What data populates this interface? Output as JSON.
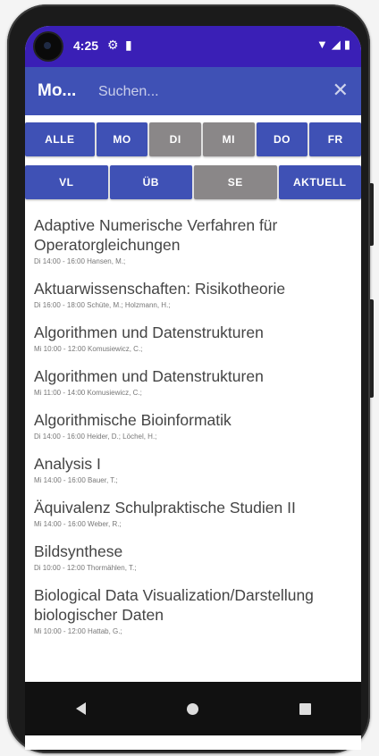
{
  "statusbar": {
    "time": "4:25"
  },
  "appbar": {
    "title": "Mo...",
    "search_placeholder": "Suchen..."
  },
  "days": [
    {
      "label": "ALLE",
      "active": false
    },
    {
      "label": "MO",
      "active": false
    },
    {
      "label": "DI",
      "active": true
    },
    {
      "label": "MI",
      "active": true
    },
    {
      "label": "DO",
      "active": false
    },
    {
      "label": "FR",
      "active": false
    }
  ],
  "types": [
    {
      "label": "VL",
      "active": false
    },
    {
      "label": "ÜB",
      "active": false
    },
    {
      "label": "SE",
      "active": true
    },
    {
      "label": "AKTUELL",
      "active": false
    }
  ],
  "courses": [
    {
      "title": "Adaptive Numerische Verfahren für Operatorgleichungen",
      "meta": "Di 14:00 - 16:00 Hansen, M.;"
    },
    {
      "title": "Aktuarwissenschaften: Risikotheorie",
      "meta": "Di 16:00 - 18:00 Schüte, M.; Holzmann, H.;"
    },
    {
      "title": "Algorithmen und Datenstrukturen",
      "meta": "Mi 10:00 - 12:00 Komusiewicz, C.;"
    },
    {
      "title": "Algorithmen und Datenstrukturen",
      "meta": "Mi 11:00 - 14:00 Komusiewicz, C.;"
    },
    {
      "title": "Algorithmische Bioinformatik",
      "meta": "Di 14:00 - 16:00 Heider, D.; Löchel, H.;"
    },
    {
      "title": "Analysis I",
      "meta": "Mi 14:00 - 16:00 Bauer, T.;"
    },
    {
      "title": "Äquivalenz Schulpraktische Studien II",
      "meta": "Mi 14:00 - 16:00 Weber, R.;"
    },
    {
      "title": "Bildsynthese",
      "meta": "Di 10:00 - 12:00 Thormählen, T.;"
    },
    {
      "title": "Biological Data Visualization/Darstellung biologischer Daten",
      "meta": "Mi 10:00 - 12:00 Hattab, G.;"
    }
  ],
  "colors": {
    "statusbar": "#3a1fb6",
    "primary": "#3f51b5",
    "active": "#8a8788"
  }
}
